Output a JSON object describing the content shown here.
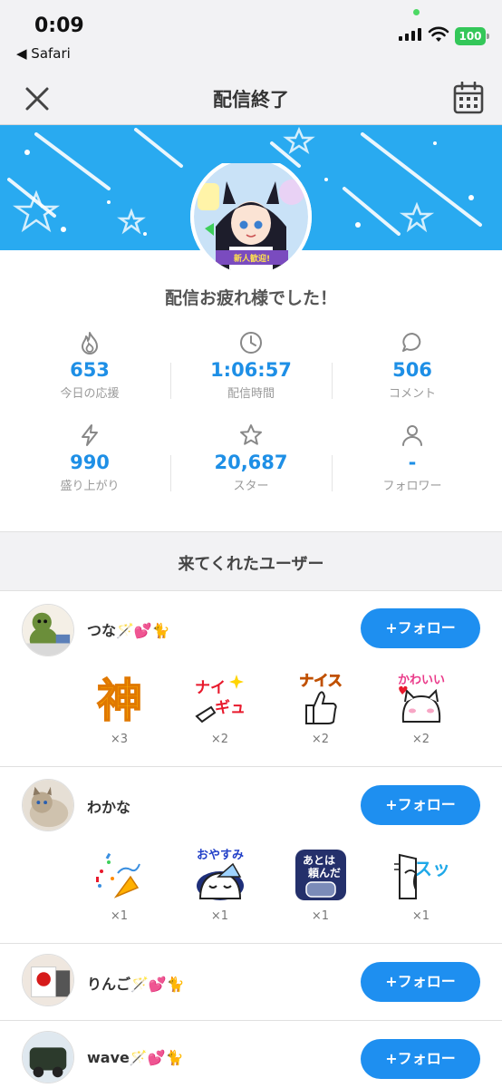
{
  "status": {
    "time": "0:09",
    "back_app": "◀ Safari",
    "battery": "100"
  },
  "nav": {
    "title": "配信終了",
    "close_icon": "close-icon",
    "calendar_icon": "calendar-icon"
  },
  "congrats": "配信お疲れ様でした！",
  "stats": [
    {
      "icon": "flame-icon",
      "value": "653",
      "label": "今日の応援"
    },
    {
      "icon": "clock-icon",
      "value": "1:06:57",
      "label": "配信時間"
    },
    {
      "icon": "comment-icon",
      "value": "506",
      "label": "コメント"
    },
    {
      "icon": "lightning-icon",
      "value": "990",
      "label": "盛り上がり"
    },
    {
      "icon": "star-icon",
      "value": "20,687",
      "label": "スター"
    },
    {
      "icon": "person-icon",
      "value": "-",
      "label": "フォロワー"
    }
  ],
  "section_title": "来てくれたユーザー",
  "follow_label": "+フォロー",
  "users": [
    {
      "name": "つな🪄💕🐈",
      "stamps": [
        {
          "icon": "kami-stamp",
          "text": "神",
          "count": "×3"
        },
        {
          "icon": "nice-gyu-stamp",
          "text": "ナイギュ",
          "count": "×2"
        },
        {
          "icon": "nice-thumb-stamp",
          "text": "ナイス",
          "count": "×2"
        },
        {
          "icon": "kawaii-stamp",
          "text": "かわいい",
          "count": "×2"
        }
      ]
    },
    {
      "name": "わかな",
      "stamps": [
        {
          "icon": "party-popper-stamp",
          "text": "",
          "count": "×1"
        },
        {
          "icon": "oyasumi-stamp",
          "text": "おやすみ",
          "count": "×1"
        },
        {
          "icon": "atowa-tanonda-stamp",
          "text": "あとは頼んだ",
          "count": "×1"
        },
        {
          "icon": "sutt-stamp",
          "text": "スッ",
          "count": "×1"
        }
      ]
    },
    {
      "name": "りんご🪄💕🐈"
    },
    {
      "name": "wave🪄💕🐈"
    }
  ]
}
